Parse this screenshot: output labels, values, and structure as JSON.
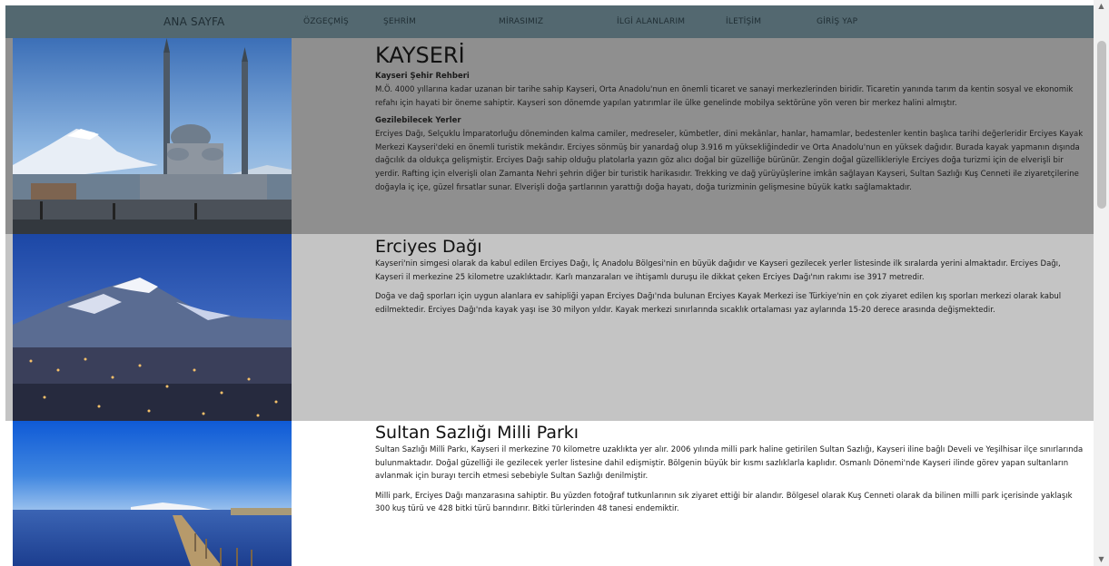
{
  "nav": {
    "items": [
      {
        "label": "ANA SAYFA"
      },
      {
        "label": "ÖZGEÇMİŞ"
      },
      {
        "label": "ŞEHRİM"
      },
      {
        "label": "MİRASIMIZ"
      },
      {
        "label": "İLGİ ALANLARIM"
      },
      {
        "label": "İLETİŞİM"
      },
      {
        "label": "GİRİŞ YAP"
      }
    ]
  },
  "colors": {
    "navbar": "#536870",
    "section1_bg": "#8f8f8f",
    "section2_bg": "#c4c4c4",
    "section3_bg": "#ffffff"
  },
  "sections": [
    {
      "title": "KAYSERİ",
      "image": "kayseri-mosque-photo",
      "subheading1": "Kayseri Şehir Rehberi",
      "paragraph1": "M.Ö. 4000 yıllarına kadar uzanan bir tarihe sahip Kayseri, Orta Anadolu'nun en önemli ticaret ve sanayi merkezlerinden biridir. Ticaretin yanında tarım da kentin sosyal ve ekonomik refahı için hayati bir öneme sahiptir. Kayseri son dönemde yapılan yatırımlar ile ülke genelinde mobilya sektörüne yön veren bir merkez halini almıştır.",
      "subheading2": "Gezilebilecek Yerler",
      "paragraph2": "Erciyes Dağı, Selçuklu İmparatorluğu döneminden kalma camiler, medreseler, kümbetler, dini mekânlar, hanlar, hamamlar, bedestenler kentin başlıca tarihi değerleridir Erciyes Kayak Merkezi Kayseri'deki en önemli turistik mekândır. Erciyes sönmüş bir yanardağ olup 3.916 m yüksekliğindedir ve Orta Anadolu'nun en yüksek dağıdır. Burada kayak yapmanın dışında dağcılık da oldukça gelişmiştir. Erciyes Dağı sahip olduğu platolarla yazın göz alıcı doğal bir güzelliğe bürünür. Zengin doğal güzellikleriyle Erciyes doğa turizmi için de elverişli bir yerdir. Rafting için elverişli olan Zamanta Nehri şehrin diğer bir turistik harikasıdır. Trekking ve dağ yürüyüşlerine imkân sağlayan Kayseri, Sultan Sazlığı Kuş Cenneti ile ziyaretçilerine doğayla iç içe, güzel fırsatlar sunar. Elverişli doğa şartlarının yarattığı doğa hayatı, doğa turizminin gelişmesine büyük katkı sağlamaktadır."
    },
    {
      "title": "Erciyes Dağı",
      "image": "erciyes-mountain-photo",
      "paragraph1": "Kayseri'nin simgesi olarak da kabul edilen Erciyes Dağı, İç Anadolu Bölgesi'nin en büyük dağıdır ve Kayseri gezilecek yerler listesinde ilk sıralarda yerini almaktadır. Erciyes Dağı, Kayseri il merkezine 25 kilometre uzaklıktadır. Karlı manzaraları ve ihtişamlı duruşu ile dikkat çeken Erciyes Dağı'nın rakımı ise 3917 metredir.",
      "paragraph2": "Doğa ve dağ sporları için uygun alanlara ev sahipliği yapan Erciyes Dağı'nda bulunan Erciyes Kayak Merkezi ise Türkiye'nin en çok ziyaret edilen kış sporları merkezi olarak kabul edilmektedir. Erciyes Dağı'nda kayak yaşı ise 30 milyon yıldır. Kayak merkezi sınırlarında sıcaklık ortalaması yaz aylarında 15-20 derece arasında değişmektedir."
    },
    {
      "title": "Sultan Sazlığı Milli Parkı",
      "image": "sultan-sazligi-lake-photo",
      "paragraph1": "Sultan Sazlığı Milli Parkı, Kayseri il merkezine 70 kilometre uzaklıkta yer alır. 2006 yılında milli park haline getirilen Sultan Sazlığı, Kayseri iline bağlı Develi ve Yeşilhisar ilçe sınırlarında bulunmaktadır. Doğal güzelliği ile gezilecek yerler listesine dahil edişmiştir. Bölgenin büyük bir kısmı sazlıklarla kaplıdır. Osmanlı Dönemi'nde Kayseri ilinde görev yapan sultanların avlanmak için burayı tercih etmesi sebebiyle Sultan Sazlığı denilmiştir.",
      "paragraph2": "Milli park, Erciyes Dağı manzarasına sahiptir. Bu yüzden fotoğraf tutkunlarının sık ziyaret ettiği bir alandır. Bölgesel olarak Kuş Cenneti olarak da bilinen milli park içerisinde yaklaşık 300 kuş türü ve 428 bitki türü barındırır. Bitki türlerinden 48 tanesi endemiktir."
    }
  ]
}
